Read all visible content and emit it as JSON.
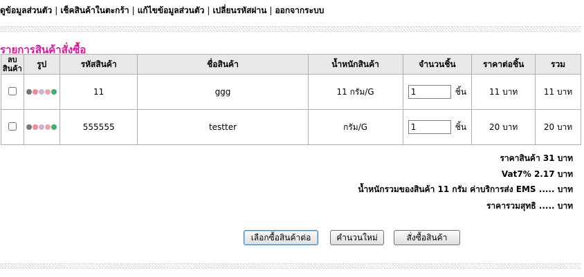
{
  "nav": {
    "items": [
      "ดูข้อมูลส่วนตัว",
      "เช็คสินค้าในตะกร้า",
      "แก้ไขข้อมูลส่วนตัว",
      "เปลี่ยนรหัสผ่าน",
      "ออกจากระบบ"
    ],
    "separator": "|"
  },
  "section_title": "รายการสินค้าสั่งซื้อ",
  "table": {
    "headers": {
      "delete_line1": "ลบ",
      "delete_line2": "สินค้า",
      "image": "รูป",
      "code": "รหัสสินค้า",
      "name": "ชื่อสินค้า",
      "weight": "น้ำหนักสินค้า",
      "quantity": "จำนวนชิ้น",
      "unit_price": "ราคาต่อชิ้น",
      "total": "รวม"
    },
    "rows": [
      {
        "code": "11",
        "name": "ggg",
        "weight": "11 กรัม/G",
        "quantity": "1",
        "qty_unit": "ชิ้น",
        "unit_price": "11 บาท",
        "total": "11 บาท"
      },
      {
        "code": "555555",
        "name": "testter",
        "weight": "กรัม/G",
        "quantity": "1",
        "qty_unit": "ชิ้น",
        "unit_price": "20 บาท",
        "total": "20 บาท"
      }
    ],
    "image_dot_colors": [
      "#777777",
      "#f08a9e",
      "#c8b8c8",
      "#f0a0b0",
      "#40b070"
    ]
  },
  "summary": {
    "product_price": "ราคาสินค้า 31 บาท",
    "vat": "Vat7% 2.17 บาท",
    "shipping": "น้ำหนักรวมของสินค้า 11  กรัม ค่าบริการส่ง EMS ..... บาท",
    "net_total": "ราคารวมสุทธิ ..... บาท"
  },
  "buttons": {
    "continue_shopping": "เลือกซื้อสินค้าต่อ",
    "recalculate": "คำนวนใหม่",
    "order": "สั่งซื้อสินค้า"
  },
  "colors": {
    "accent": "#e0149a"
  }
}
